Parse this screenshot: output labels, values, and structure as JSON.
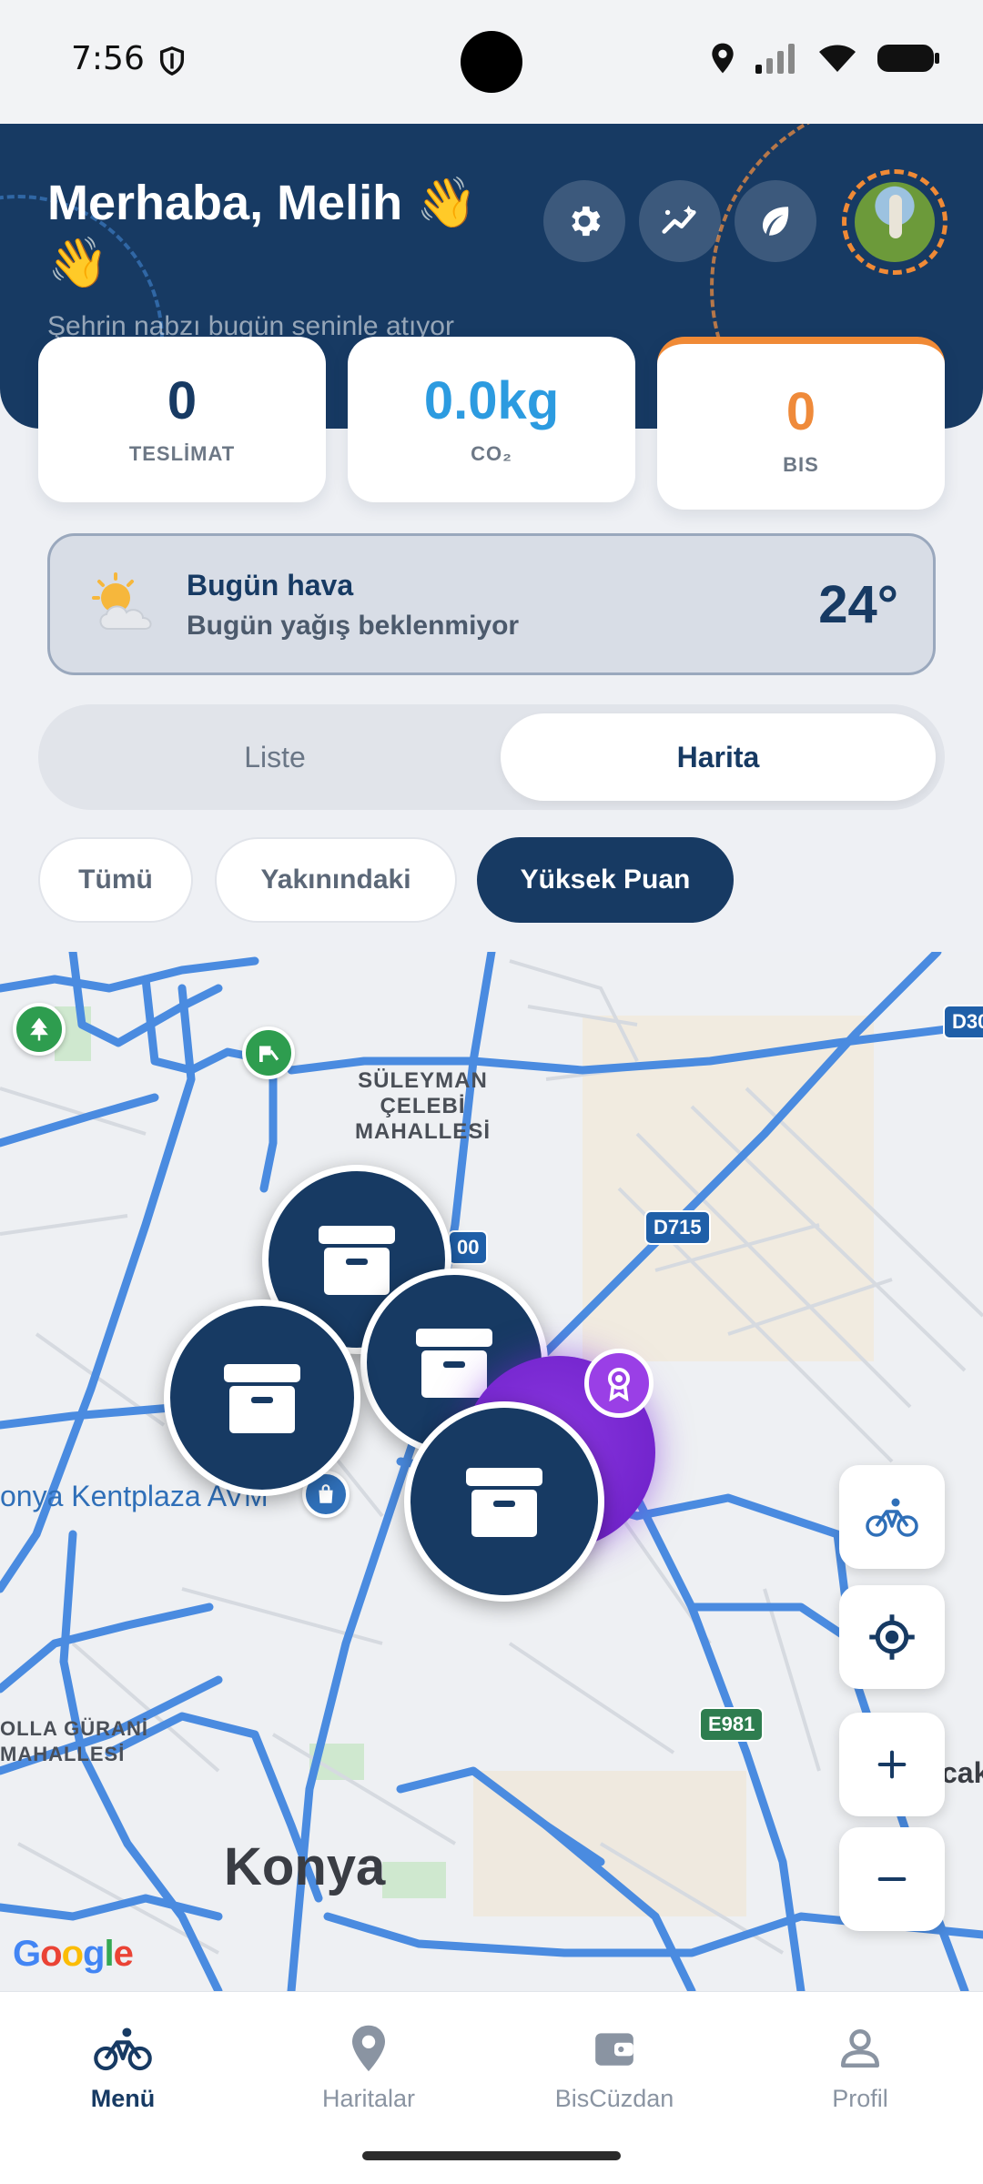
{
  "status_bar": {
    "time": "7:56"
  },
  "header": {
    "greeting": "Merhaba, Melih 👋 👋",
    "subtitle": "Şehrin nabzı bugün seninle atıyor",
    "avatar_initials": ""
  },
  "stats": [
    {
      "value": "0",
      "label": "TESLİMAT",
      "color": "#173a63"
    },
    {
      "value": "0.0kg",
      "label": "CO₂",
      "color": "#2c9be0"
    },
    {
      "value": "0",
      "label": "BIS",
      "color": "#ef8a3a"
    }
  ],
  "weather": {
    "title": "Bugün hava",
    "description": "Bugün yağış beklenmiyor",
    "temperature": "24°",
    "icon": "partly-cloudy-icon"
  },
  "view_toggle": {
    "list_label": "Liste",
    "map_label": "Harita",
    "selected": "Harita"
  },
  "filters": [
    {
      "label": "Tümü",
      "active": false
    },
    {
      "label": "Yakınındaki",
      "active": false
    },
    {
      "label": "Yüksek Puan",
      "active": true
    }
  ],
  "map": {
    "labels": {
      "district1_line1": "SÜLEYMAN",
      "district1_line2": "ÇELEBİ",
      "district1_line3": "MAHALLESİ",
      "district2_line1": "OLLA GÜRANİ",
      "district2_line2": "MAHALLESİ",
      "city": "Konya",
      "poi_mall": "onya Kentplaza AVM",
      "edge_right": "cak"
    },
    "road_shields": {
      "d715": "D715",
      "d300": "D30",
      "d300b": "00",
      "e981": "E981"
    },
    "attribution": "Google",
    "controls": [
      "bike-mode-icon",
      "my-location-icon",
      "zoom-in-icon",
      "zoom-out-icon"
    ]
  },
  "bottom_nav": [
    {
      "label": "Menü",
      "icon": "bike-icon",
      "active": true
    },
    {
      "label": "Haritalar",
      "icon": "map-pin-icon",
      "active": false
    },
    {
      "label": "BisCüzdan",
      "icon": "wallet-icon",
      "active": false
    },
    {
      "label": "Profil",
      "icon": "profile-icon",
      "active": false
    }
  ]
}
